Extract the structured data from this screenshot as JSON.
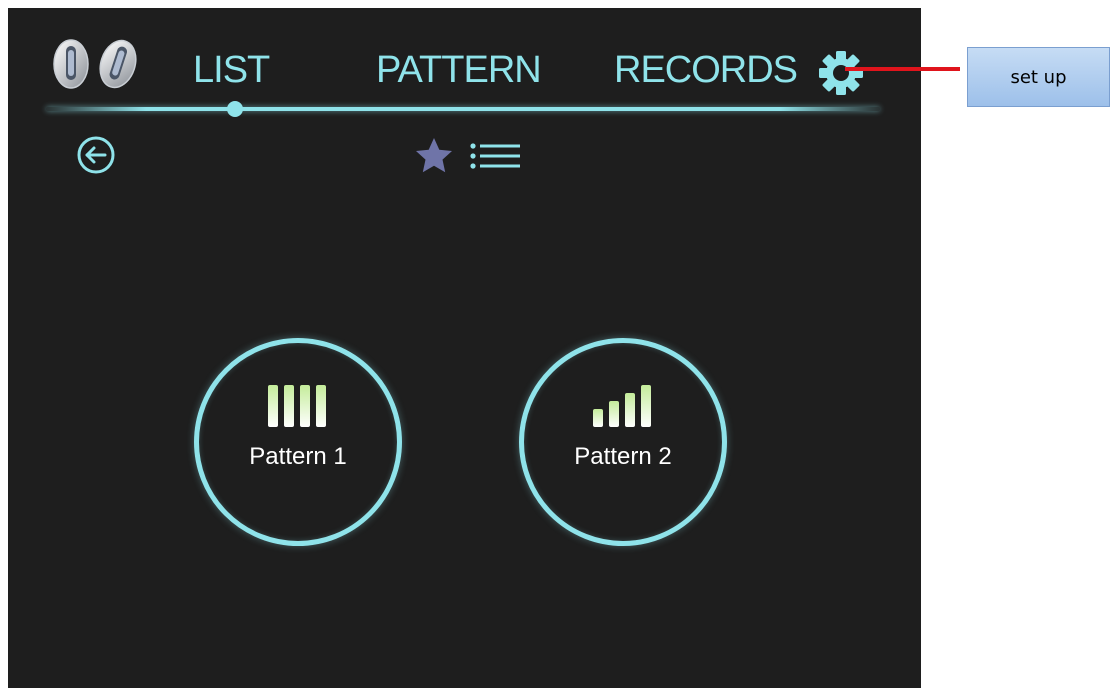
{
  "nav": {
    "tabs": [
      {
        "label": "LIST",
        "active": true
      },
      {
        "label": "PATTERN",
        "active": false
      },
      {
        "label": "RECORDS",
        "active": false
      }
    ],
    "settings_icon": "gear-icon",
    "logo_icon": "earbuds-icon"
  },
  "toolbar": {
    "back_icon": "back-arrow-circle-icon",
    "favorites_icon": "star-icon",
    "list_icon": "list-icon"
  },
  "patterns": [
    {
      "label": "Pattern 1",
      "icon": "equal-bars-icon"
    },
    {
      "label": "Pattern 2",
      "icon": "signal-bars-icon"
    }
  ],
  "annotation": {
    "label": "set up",
    "target": "settings gear"
  },
  "colors": {
    "background": "#1e1e1e",
    "accent": "#8fe3ea",
    "star": "#6f74a8",
    "callout_line": "#e0141c",
    "callout_box": "#b3cfef"
  }
}
